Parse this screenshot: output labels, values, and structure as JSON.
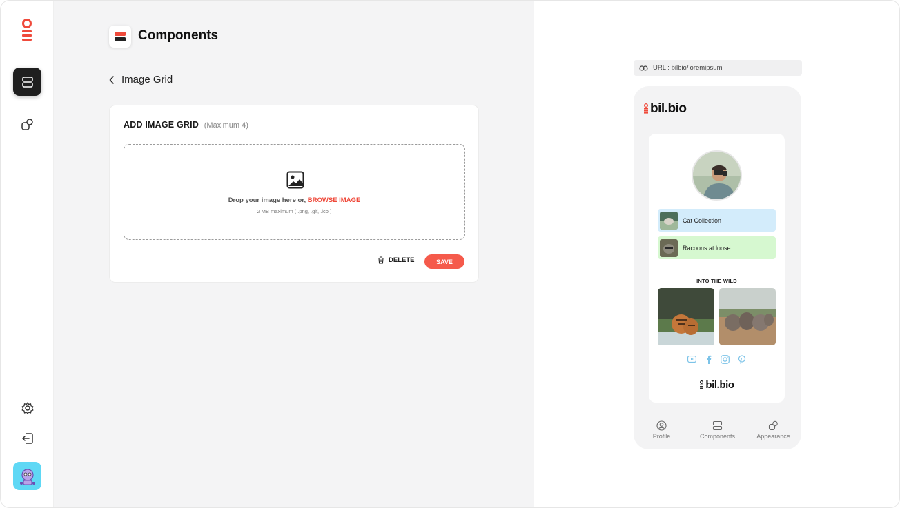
{
  "sidebar": {
    "logo": "bilbio-logo-icon",
    "nav": [
      {
        "name": "components",
        "icon": "layers-icon",
        "active": true
      },
      {
        "name": "appearance",
        "icon": "shapes-icon",
        "active": false
      }
    ],
    "bottom": [
      {
        "name": "settings",
        "icon": "gear-icon"
      },
      {
        "name": "logout",
        "icon": "logout-icon"
      },
      {
        "name": "user-avatar",
        "icon": "robot-avatar-icon"
      }
    ]
  },
  "header": {
    "title": "Components"
  },
  "back": {
    "label": "Image Grid"
  },
  "card": {
    "title": "ADD IMAGE GRID",
    "subtitle": "(Maximum 4)",
    "drop_text": "Drop your image here or,",
    "drop_link": "BROWSE IMAGE",
    "drop_hint": "2 MB maximum ( .png, .gif, .ico )",
    "delete_label": "DELETE",
    "save_label": "SAVE"
  },
  "preview": {
    "url_label": "URL : bilbio/loremipsum",
    "brand": "bil.bio",
    "links": [
      {
        "label": "Cat Collection",
        "color": "#d3ecfb"
      },
      {
        "label": "Racoons at loose",
        "color": "#d6f8d0"
      }
    ],
    "section_title": "INTO THE WILD",
    "socials": [
      "youtube-icon",
      "facebook-icon",
      "instagram-icon",
      "pinterest-icon"
    ],
    "footer_brand": "bil.bio",
    "tabs": [
      {
        "label": "Profile",
        "icon": "user-circle-icon"
      },
      {
        "label": "Components",
        "icon": "layers-icon"
      },
      {
        "label": "Appearance",
        "icon": "shapes-icon"
      }
    ]
  },
  "colors": {
    "accent": "#f55a4b",
    "link": "#ef4a3b",
    "social": "#7cc3e8"
  }
}
